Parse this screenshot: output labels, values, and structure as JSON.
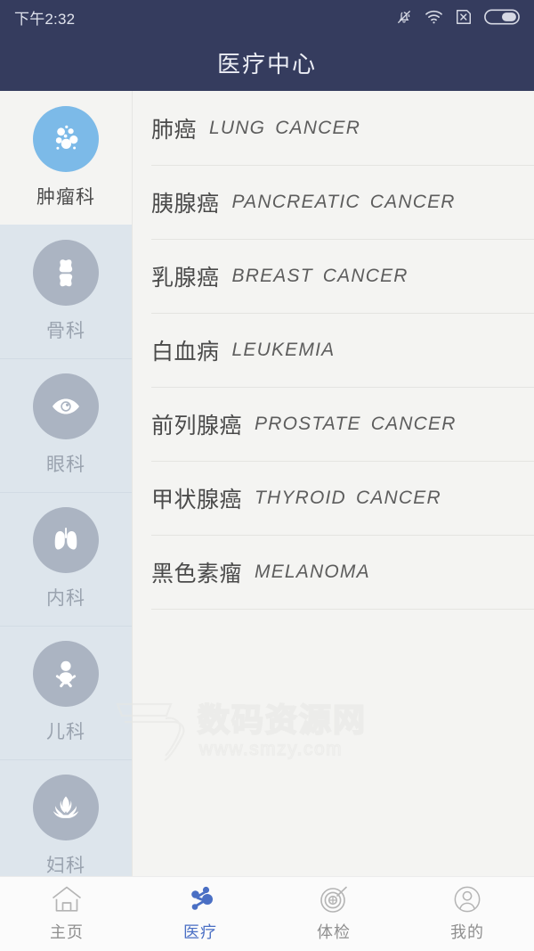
{
  "status_bar": {
    "time": "下午2:32",
    "icons": [
      "bell-muted-icon",
      "wifi-icon",
      "sim-no-signal-icon",
      "battery-icon"
    ]
  },
  "header": {
    "title": "医疗中心"
  },
  "sidebar": {
    "items": [
      {
        "label": "肿瘤科",
        "icon": "tumor-cells-icon",
        "active": true
      },
      {
        "label": "骨科",
        "icon": "knee-joint-icon",
        "active": false
      },
      {
        "label": "眼科",
        "icon": "eye-icon",
        "active": false
      },
      {
        "label": "内科",
        "icon": "lungs-icon",
        "active": false
      },
      {
        "label": "儿科",
        "icon": "baby-icon",
        "active": false
      },
      {
        "label": "妇科",
        "icon": "lotus-icon",
        "active": false
      }
    ]
  },
  "list": {
    "rows": [
      {
        "cn": "肺癌",
        "en": "LUNG  CANCER"
      },
      {
        "cn": "胰腺癌",
        "en": "PANCREATIC  CANCER"
      },
      {
        "cn": "乳腺癌",
        "en": "BREAST  CANCER"
      },
      {
        "cn": "白血病",
        "en": "LEUKEMIA"
      },
      {
        "cn": "前列腺癌",
        "en": "PROSTATE  CANCER"
      },
      {
        "cn": "甲状腺癌",
        "en": "THYROID  CANCER"
      },
      {
        "cn": "黑色素瘤",
        "en": "MELANOMA"
      }
    ]
  },
  "watermark": {
    "text_cn": "数码资源网",
    "text_url": "www.smzy.com"
  },
  "tabbar": {
    "items": [
      {
        "label": "主页",
        "icon": "home-icon",
        "active": false
      },
      {
        "label": "医疗",
        "icon": "molecule-icon",
        "active": true
      },
      {
        "label": "体检",
        "icon": "target-icon",
        "active": false
      },
      {
        "label": "我的",
        "icon": "person-icon",
        "active": false
      }
    ]
  },
  "colors": {
    "header_bg": "#353c5e",
    "accent_blue": "#4a6fc4",
    "active_icon_blue": "#7cbae8",
    "inactive_icon_grey": "#abb4c2",
    "sidebar_bg": "#dde5ec",
    "page_bg": "#f4f4f2"
  }
}
